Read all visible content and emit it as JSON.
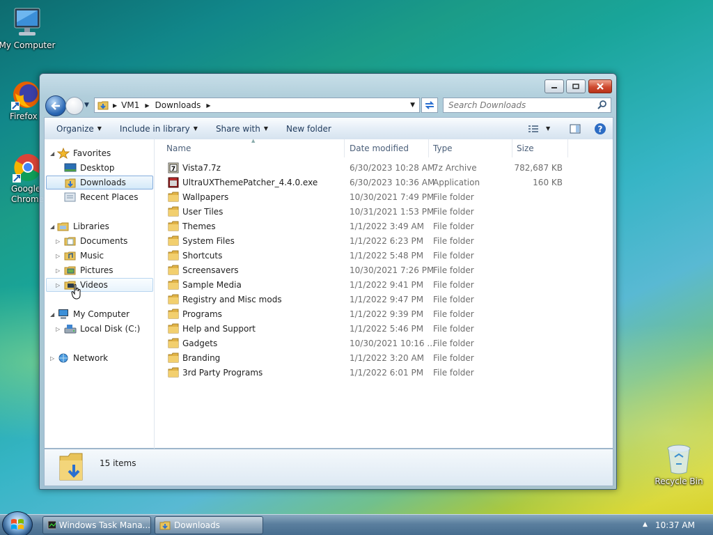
{
  "desktop": {
    "icons": [
      {
        "label": "My Computer",
        "icon": "computer-icon"
      },
      {
        "label": "Firefox",
        "icon": "firefox-icon"
      },
      {
        "label": "Google Chrome",
        "icon": "chrome-icon"
      },
      {
        "label": "Recycle Bin",
        "icon": "recycle-bin-icon"
      }
    ]
  },
  "window": {
    "breadcrumb": [
      "VM1",
      "Downloads"
    ],
    "search_placeholder": "Search Downloads",
    "toolbar": {
      "organize": "Organize",
      "include_in_library": "Include in library",
      "share_with": "Share with",
      "new_folder": "New folder"
    },
    "nav_tree": {
      "favorites": "Favorites",
      "favorites_items": [
        "Desktop",
        "Downloads",
        "Recent Places"
      ],
      "libraries": "Libraries",
      "libraries_items": [
        "Documents",
        "Music",
        "Pictures",
        "Videos"
      ],
      "computer": "My Computer",
      "computer_items": [
        "Local Disk (C:)"
      ],
      "network": "Network",
      "selected": "Downloads"
    },
    "columns": {
      "name": "Name",
      "date": "Date modified",
      "type": "Type",
      "size": "Size"
    },
    "files": [
      {
        "name": "Vista7.7z",
        "date": "6/30/2023 10:28 AM",
        "type": "7z Archive",
        "size": "782,687 KB",
        "icon": "archive-icon"
      },
      {
        "name": "UltraUXThemePatcher_4.4.0.exe",
        "date": "6/30/2023 10:36 AM",
        "type": "Application",
        "size": "160 KB",
        "icon": "application-icon"
      },
      {
        "name": "Wallpapers",
        "date": "10/30/2021 7:49 PM",
        "type": "File folder",
        "size": "",
        "icon": "folder-icon"
      },
      {
        "name": "User Tiles",
        "date": "10/31/2021 1:53 PM",
        "type": "File folder",
        "size": "",
        "icon": "folder-icon"
      },
      {
        "name": "Themes",
        "date": "1/1/2022 3:49 AM",
        "type": "File folder",
        "size": "",
        "icon": "folder-icon"
      },
      {
        "name": "System Files",
        "date": "1/1/2022 6:23 PM",
        "type": "File folder",
        "size": "",
        "icon": "folder-icon"
      },
      {
        "name": "Shortcuts",
        "date": "1/1/2022 5:48 PM",
        "type": "File folder",
        "size": "",
        "icon": "folder-icon"
      },
      {
        "name": "Screensavers",
        "date": "10/30/2021 7:26 PM",
        "type": "File folder",
        "size": "",
        "icon": "folder-icon"
      },
      {
        "name": "Sample Media",
        "date": "1/1/2022 9:41 PM",
        "type": "File folder",
        "size": "",
        "icon": "folder-icon"
      },
      {
        "name": "Registry and Misc mods",
        "date": "1/1/2022 9:47 PM",
        "type": "File folder",
        "size": "",
        "icon": "folder-icon"
      },
      {
        "name": "Programs",
        "date": "1/1/2022 9:39 PM",
        "type": "File folder",
        "size": "",
        "icon": "folder-icon"
      },
      {
        "name": "Help and Support",
        "date": "1/1/2022 5:46 PM",
        "type": "File folder",
        "size": "",
        "icon": "folder-icon"
      },
      {
        "name": "Gadgets",
        "date": "10/30/2021 10:16 ...",
        "type": "File folder",
        "size": "",
        "icon": "folder-icon"
      },
      {
        "name": "Branding",
        "date": "1/1/2022 3:20 AM",
        "type": "File folder",
        "size": "",
        "icon": "folder-icon"
      },
      {
        "name": "3rd Party Programs",
        "date": "1/1/2022 6:01 PM",
        "type": "File folder",
        "size": "",
        "icon": "folder-icon"
      }
    ],
    "status": {
      "item_count": "15 items"
    }
  },
  "taskbar": {
    "tasks": [
      {
        "label": "Windows Task Mana...",
        "icon": "task-manager-icon",
        "active": false
      },
      {
        "label": "Downloads",
        "icon": "folder-icon",
        "active": true
      }
    ],
    "clock": "10:37 AM"
  }
}
